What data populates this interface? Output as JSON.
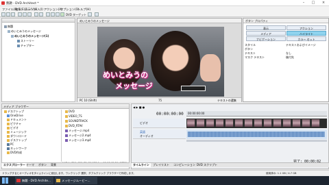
{
  "window": {
    "title": "無題 - DVD Architect *"
  },
  "menu": [
    "ファイル(F)",
    "編集(E)",
    "表示(V)",
    "挿入(I)",
    "アクション(A)",
    "オプション(O)",
    "ヘルプ(H)"
  ],
  "toolbar": {
    "target": "DVD ターゲット"
  },
  "project_tree": {
    "items": [
      "無題",
      "めいとみうのメッセージ",
      "めいとみうのメッセージ(1)",
      "ストーリー",
      "チャプター"
    ]
  },
  "preview": {
    "tab": "めいとみうのメッセージ",
    "caption_line1": "めいとみうの",
    "caption_line2": "メッセージ",
    "footer_mode": "PC 10 (Shift)",
    "footer_zoom": "75",
    "footer_btn": "テキストの選集"
  },
  "props": {
    "header": "ボタン プロパティ",
    "btn_rows": [
      [
        "表示",
        "アクション"
      ],
      [
        "メディア",
        "ハイライト"
      ],
      [
        "ナビゲーション",
        "カラー セット"
      ]
    ],
    "rows": [
      "スタイル",
      "ボタン",
      "テキスト",
      "マスク テキスト"
    ],
    "values": [
      "テキストおよびイメージ",
      "",
      "なし",
      "後付先"
    ]
  },
  "explorer": {
    "header": "メディア ブラウザー",
    "folders": [
      "デスクトップ",
      "OneDrive",
      "ドキュメント",
      "ピクチャ",
      "ビデオ",
      "ミュージック",
      "ダウンロード",
      "デスクトップ",
      "PC",
      "ネットワーク",
      "DVD作成"
    ],
    "files": [
      "DVD",
      "VIDEO_TS",
      "SOUNDTRACK",
      "DVD_RTAV",
      "メッセージ.mp4",
      "メッセージ2.mp4",
      "メッセージ3.mp4"
    ],
    "info": "ビデオ: 720x480x32, 29.970 fps, 00:00:12:29, MPEG-2",
    "tabs": [
      "エクスプローラー",
      "テーマ",
      "ボタン",
      "背景"
    ]
  },
  "timeline": {
    "time_top": "00:00:00:00",
    "time_ruler": "00:00:00:00",
    "track_video": "ビデオ",
    "track_audio": "オーディオ",
    "track_audio2": "英語",
    "tabs": [
      "タイムライン",
      "プレイリスト",
      "コンピレーション",
      "DVD スクリプト"
    ],
    "status": "完了: 00:00:02"
  },
  "statusbar": {
    "left": "ドラッグするとオーディオをタイムラインに追加します。ワンクリック 選択、ダブルクリック ブラウザーで作成します。",
    "right": "使用済の: 1.1 GB / 4.7 GB"
  },
  "taskbar": {
    "items": [
      "無題 - DVD Archite...",
      "メッセージムービー..."
    ]
  }
}
